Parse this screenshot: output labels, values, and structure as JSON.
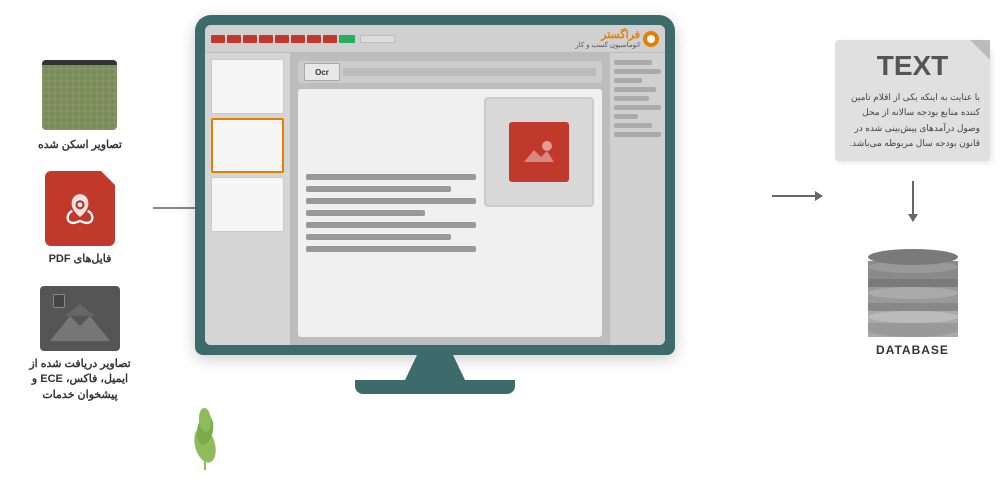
{
  "brand": {
    "name": "فراگستر",
    "subtitle": "اتوماسیون کسب و کار"
  },
  "left_items": [
    {
      "id": "scanned",
      "label": "تصاویر اسکن شده"
    },
    {
      "id": "pdf",
      "label": "فایل‌های PDF"
    },
    {
      "id": "email",
      "label": "تصاویر دریافت شده از ایمیل، فاکس، ECE و پیشخوان خدمات"
    }
  ],
  "screen": {
    "ocr_label": "Ocr"
  },
  "text_card": {
    "title": "TEXT",
    "body": "با عنایت به اینکه یکی از اقلام تامین کننده منابع بودجه سالانه از محل وصول درآمدهای پیش‌بینی شده در قانون بودجه سال مربوطه می‌باشد."
  },
  "database": {
    "label": "DATABASE"
  },
  "colors": {
    "monitor_body": "#3d6b6b",
    "accent_orange": "#e67e00",
    "pdf_red": "#c0392b",
    "brand_orange": "#e67e00"
  },
  "topbar_colors": [
    "#c0392b",
    "#c0392b",
    "#c0392b",
    "#c0392b",
    "#c0392b",
    "#c0392b",
    "#c0392b",
    "#c0392b",
    "#27ae60",
    "#27ae60"
  ]
}
